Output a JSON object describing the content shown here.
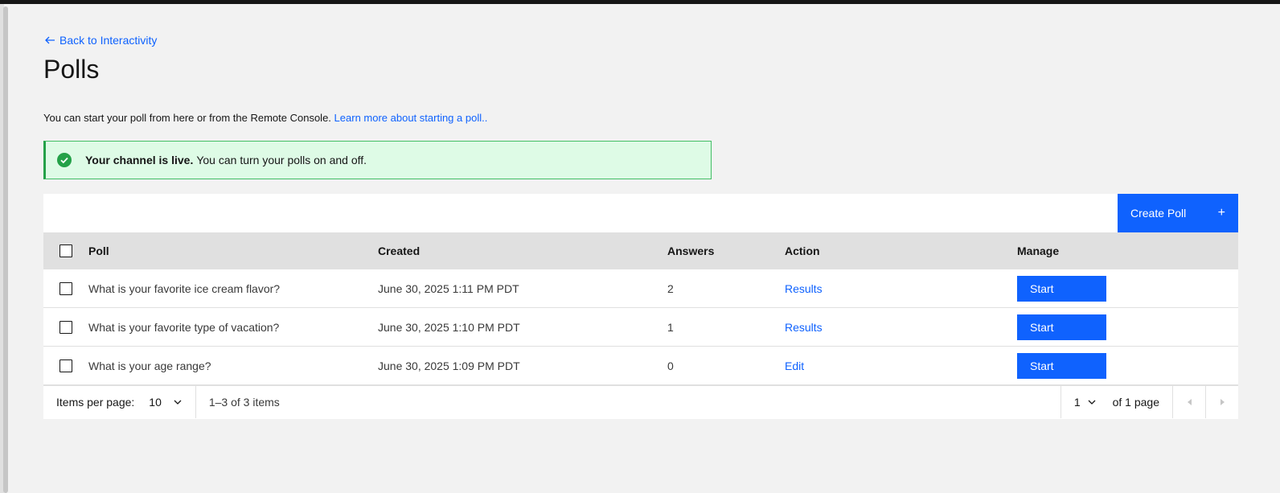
{
  "nav": {
    "back_label": "Back to Interactivity"
  },
  "page": {
    "title": "Polls"
  },
  "intro": {
    "text": "You can start your poll from here or from the Remote Console.",
    "link_label": "Learn more about starting a poll.."
  },
  "notification": {
    "icon": "checkmark-filled-icon",
    "title": "Your channel is live.",
    "message": "You can turn your polls on and off.",
    "color": "#24a148"
  },
  "toolbar": {
    "create_label": "Create Poll",
    "create_icon": "+"
  },
  "table": {
    "headers": {
      "poll": "Poll",
      "created": "Created",
      "answers": "Answers",
      "action": "Action",
      "manage": "Manage"
    },
    "rows": [
      {
        "poll": "What is your favorite ice cream flavor?",
        "created": "June 30, 2025 1:11 PM PDT",
        "answers": "2",
        "action": "Results",
        "manage": "Start"
      },
      {
        "poll": "What is your favorite type of vacation?",
        "created": "June 30, 2025 1:10 PM PDT",
        "answers": "1",
        "action": "Results",
        "manage": "Start"
      },
      {
        "poll": "What is your age range?",
        "created": "June 30, 2025 1:09 PM PDT",
        "answers": "0",
        "action": "Edit",
        "manage": "Start"
      }
    ]
  },
  "pagination": {
    "items_per_page_label": "Items per page:",
    "items_per_page_value": "10",
    "range_text": "1–3 of 3 items",
    "page_value": "1",
    "of_pages_text": "of 1 page"
  },
  "colors": {
    "accent": "#0f62fe",
    "success_bg": "#defbe6",
    "header_bg": "#e0e0e0"
  }
}
